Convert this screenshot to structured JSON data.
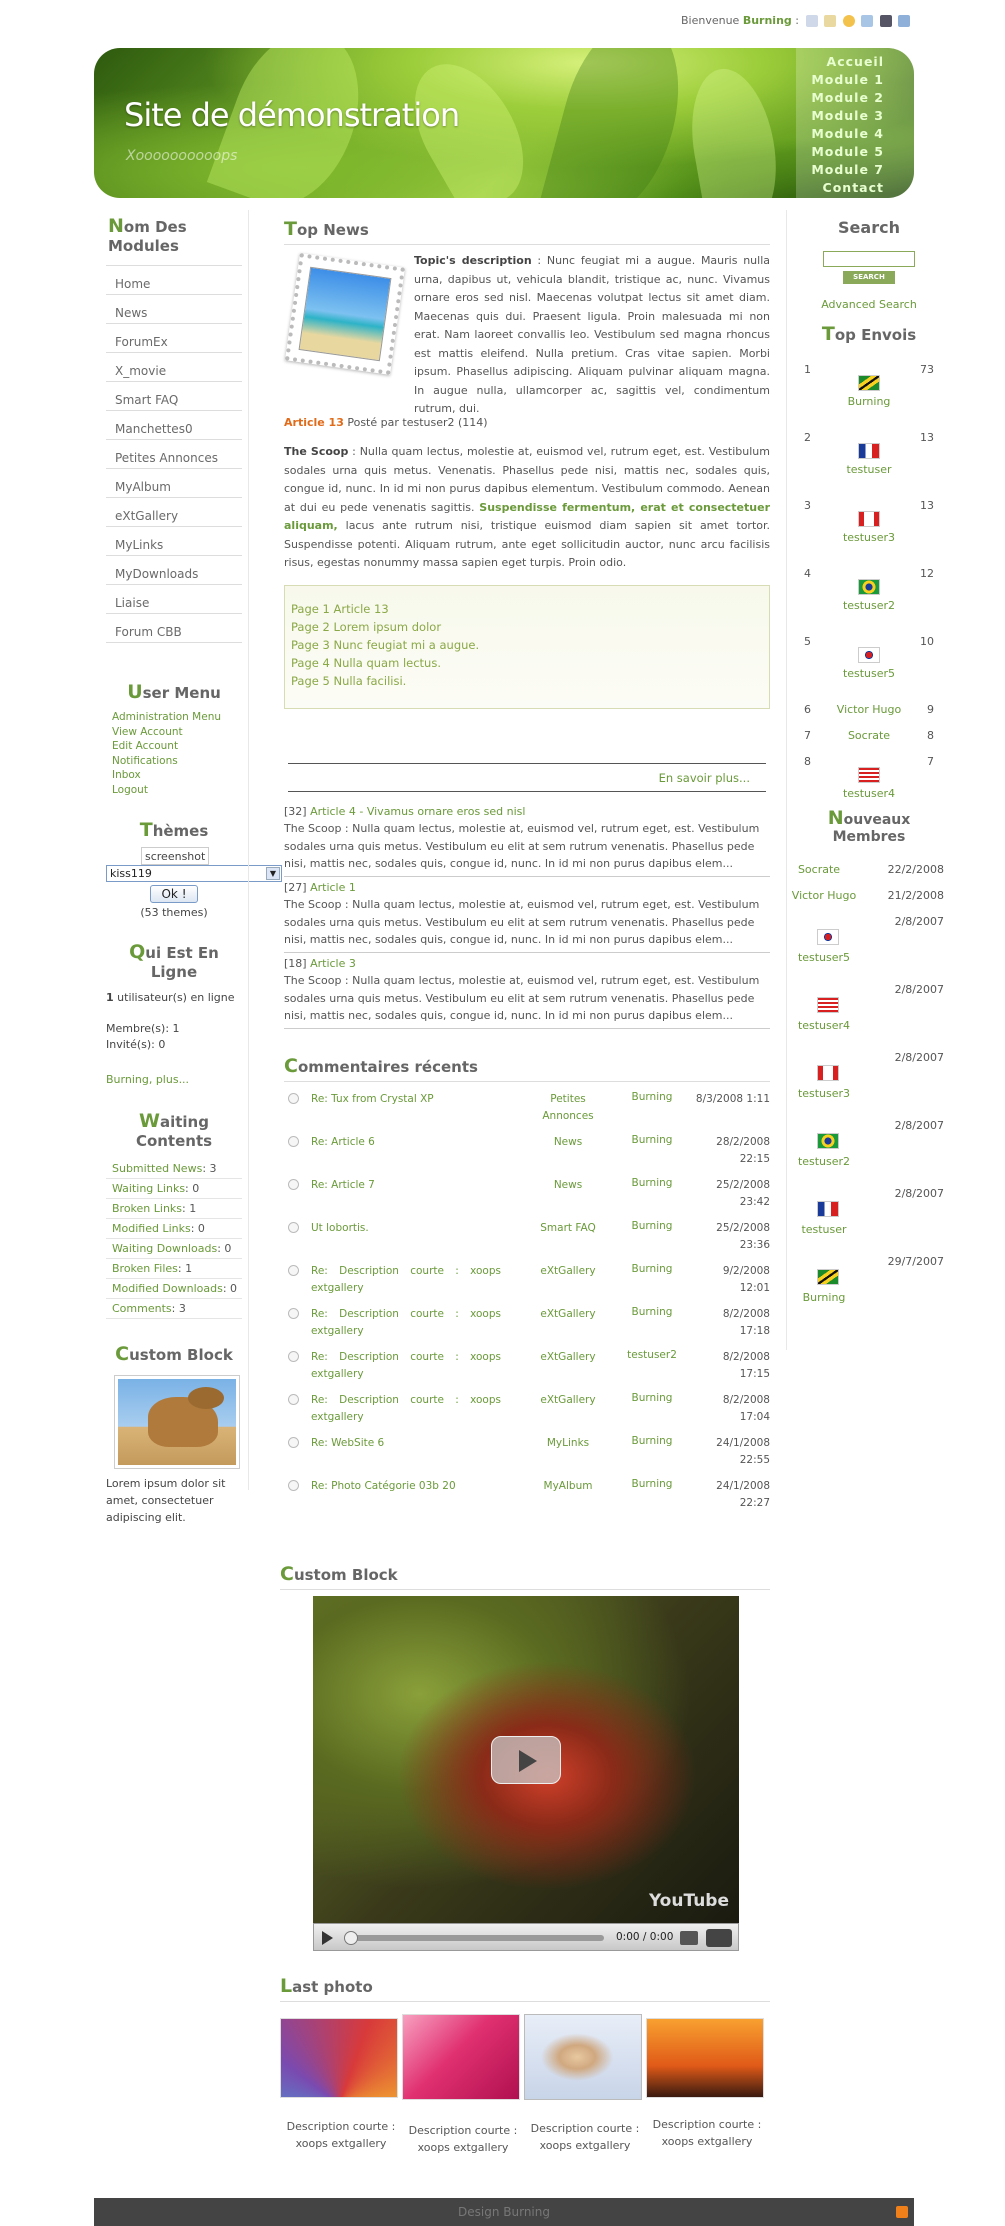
{
  "topbar": {
    "welcome": "Bienvenue",
    "username": "Burning",
    "sep": ":"
  },
  "header": {
    "title": "Site de démonstration",
    "slogan": "Xoooooooooops",
    "menu": [
      "Accueil",
      "Module 1",
      "Module 2",
      "Module 3",
      "Module 4",
      "Module 5",
      "Module 7",
      "Contact"
    ]
  },
  "modules": {
    "title_first": "N",
    "title_rest": "om Des Modules",
    "items": [
      "Home",
      "News",
      "ForumEx",
      "X_movie",
      "Smart FAQ",
      "Manchettes0",
      "Petites Annonces",
      "MyAlbum",
      "eXtGallery",
      "MyLinks",
      "MyDownloads",
      "Liaise",
      "Forum CBB"
    ]
  },
  "usermenu": {
    "title_first": "U",
    "title_rest": "ser Menu",
    "items": [
      "Administration Menu",
      "View Account",
      "Edit Account",
      "Notifications",
      "Inbox",
      "Logout"
    ]
  },
  "themes": {
    "title_first": "T",
    "title_rest": "hèmes",
    "preview": "screenshot",
    "selected": "kiss119",
    "ok": "Ok !",
    "count": "(53 themes)"
  },
  "online": {
    "title_first": "Q",
    "title_rest": "ui Est En Ligne",
    "count_num": "1",
    "count_text": " utilisateur(s) en ligne",
    "members": "Membre(s): 1",
    "guests": "Invité(s): 0",
    "more": "Burning, plus..."
  },
  "waiting": {
    "title_first": "W",
    "title_rest": "aiting Contents",
    "items": [
      {
        "k": "Submitted News",
        "v": ": 3"
      },
      {
        "k": "Waiting Links",
        "v": ": 0"
      },
      {
        "k": "Broken Links",
        "v": ": 1"
      },
      {
        "k": "Modified Links",
        "v": ": 0"
      },
      {
        "k": "Waiting Downloads",
        "v": ": 0"
      },
      {
        "k": "Broken Files",
        "v": ": 1"
      },
      {
        "k": "Modified Downloads",
        "v": ": 0"
      },
      {
        "k": "Comments",
        "v": ": 3"
      }
    ]
  },
  "customleft": {
    "title_first": "C",
    "title_rest": "ustom Block",
    "text": "Lorem ipsum dolor sit amet, consectetuer adipiscing elit."
  },
  "topnews": {
    "title_first": "T",
    "title_rest": "op News",
    "desc_label": "Topic's description",
    "desc_text": " : Nunc feugiat mi a augue. Mauris nulla urna, dapibus ut, vehicula blandit, tristique ac, nunc. Vivamus ornare eros sed nisl. Maecenas volutpat lectus sit amet diam. Maecenas quis dui. Praesent ligula. Proin malesuada mi non erat. Nam laoreet convallis leo. Vestibulum sed magna rhoncus est mattis eleifend. Nulla pretium. Cras vitae sapien. Morbi ipsum. Phasellus adipiscing. Aliquam pulvinar aliquam magna. In augue nulla, ullamcorper ac, sagittis vel, condimentum rutrum, dui.",
    "article_link": "Article 13",
    "article_meta": " Posté par testuser2 (114)",
    "scoop_label": "The Scoop",
    "scoop_a": " : Nulla quam lectus, molestie at, euismod vel, rutrum eget, est. Vestibulum sodales urna quis metus. Venenatis. Phasellus pede nisi, mattis nec, sodales quis, congue id, nunc. In id mi non purus dapibus elementum. Vestibulum commodo. Aenean at dui eu pede venenatis sagittis. ",
    "scoop_b": "Suspendisse fermentum, erat et consectetuer aliquam,",
    "scoop_c": " lacus ante rutrum nisi, tristique euismod diam sapien sit amet tortor. Suspendisse potenti. Aliquam rutrum, ante eget sollicitudin auctor, nunc arcu facilisis risus, egestas nonummy massa sapien eget turpis. Proin odio.",
    "pages": [
      "Page 1 Article 13",
      "Page 2 Lorem ipsum dolor",
      "Page 3 Nunc feugiat mi a augue.",
      "Page 4 Nulla quam lectus.",
      "Page 5 Nulla facilisi."
    ],
    "more": "En savoir plus...",
    "articles": [
      {
        "id": "[32]",
        "title": "Article 4 - Vivamus ornare eros sed nisl",
        "text": "The Scoop : Nulla quam lectus, molestie at, euismod vel, rutrum eget, est. Vestibulum sodales urna quis metus. Vestibulum eu elit at sem rutrum venenatis. Phasellus pede nisi, mattis nec, sodales quis, congue id, nunc. In id mi non purus dapibus elem..."
      },
      {
        "id": "[27]",
        "title": "Article 1",
        "text": "The Scoop : Nulla quam lectus, molestie at, euismod vel, rutrum eget, est. Vestibulum sodales urna quis metus. Vestibulum eu elit at sem rutrum venenatis. Phasellus pede nisi, mattis nec, sodales quis, congue id, nunc. In id mi non purus dapibus elem..."
      },
      {
        "id": "[18]",
        "title": "Article 3",
        "text": "The Scoop : Nulla quam lectus, molestie at, euismod vel, rutrum eget, est. Vestibulum sodales urna quis metus. Vestibulum eu elit at sem rutrum venenatis. Phasellus pede nisi, mattis nec, sodales quis, congue id, nunc. In id mi non purus dapibus elem..."
      }
    ]
  },
  "comments": {
    "title_first": "C",
    "title_rest": "ommentaires récents",
    "rows": [
      {
        "t": "Re: Tux from Crystal XP",
        "m": "Petites Annonces",
        "u": "Burning",
        "d": "8/3/2008 1:11"
      },
      {
        "t": "Re: Article 6",
        "m": "News",
        "u": "Burning",
        "d": "28/2/2008 22:15"
      },
      {
        "t": "Re: Article 7",
        "m": "News",
        "u": "Burning",
        "d": "25/2/2008 23:42"
      },
      {
        "t": "Ut lobortis.",
        "m": "Smart FAQ",
        "u": "Burning",
        "d": "25/2/2008 23:36"
      },
      {
        "t": "Re: Description courte : xoops extgallery",
        "m": "eXtGallery",
        "u": "Burning",
        "d": "9/2/2008 12:01"
      },
      {
        "t": "Re: Description courte : xoops extgallery",
        "m": "eXtGallery",
        "u": "Burning",
        "d": "8/2/2008 17:18"
      },
      {
        "t": "Re: Description courte : xoops extgallery",
        "m": "eXtGallery",
        "u": "testuser2",
        "d": "8/2/2008 17:15"
      },
      {
        "t": "Re: Description courte : xoops extgallery",
        "m": "eXtGallery",
        "u": "Burning",
        "d": "8/2/2008 17:04"
      },
      {
        "t": "Re: WebSite 6",
        "m": "MyLinks",
        "u": "Burning",
        "d": "24/1/2008 22:55"
      },
      {
        "t": "Re: Photo Catégorie 03b 20",
        "m": "MyAlbum",
        "u": "Burning",
        "d": "24/1/2008 22:27"
      }
    ]
  },
  "customvideo": {
    "title_first": "C",
    "title_rest": "ustom Block",
    "time": "0:00 / 0:00",
    "brand": "YouTube"
  },
  "lastphoto": {
    "title_first": "L",
    "title_rest": "ast photo",
    "caption": "Description courte : xoops extgallery",
    "count": 4
  },
  "search": {
    "title": "Search",
    "button": "Search",
    "advanced": "Advanced Search"
  },
  "topenvois": {
    "title_first": "T",
    "title_rest": "op Envois",
    "rows": [
      {
        "n": "1",
        "c": "73",
        "name": "Burning",
        "flag": "jm"
      },
      {
        "n": "2",
        "c": "13",
        "name": "testuser",
        "flag": "fr"
      },
      {
        "n": "3",
        "c": "13",
        "name": "testuser3",
        "flag": "ca"
      },
      {
        "n": "4",
        "c": "12",
        "name": "testuser2",
        "flag": "br"
      },
      {
        "n": "5",
        "c": "10",
        "name": "testuser5",
        "flag": "kr"
      },
      {
        "n": "6",
        "c": "9",
        "name": "Victor Hugo",
        "flag": ""
      },
      {
        "n": "7",
        "c": "8",
        "name": "Socrate",
        "flag": ""
      },
      {
        "n": "8",
        "c": "7",
        "name": "testuser4",
        "flag": "us"
      }
    ]
  },
  "newmembers": {
    "title_first": "N",
    "title_rest": "ouveaux Membres",
    "rows": [
      {
        "name": "Socrate",
        "date": "22/2/2008",
        "flag": ""
      },
      {
        "name": "Victor Hugo",
        "date": "21/2/2008",
        "flag": ""
      },
      {
        "name": "testuser5",
        "date": "2/8/2007",
        "flag": "kr"
      },
      {
        "name": "testuser4",
        "date": "2/8/2007",
        "flag": "us"
      },
      {
        "name": "testuser3",
        "date": "2/8/2007",
        "flag": "ca"
      },
      {
        "name": "testuser2",
        "date": "2/8/2007",
        "flag": "br"
      },
      {
        "name": "testuser",
        "date": "2/8/2007",
        "flag": "fr"
      },
      {
        "name": "Burning",
        "date": "29/7/2007",
        "flag": "jm"
      }
    ]
  },
  "footer": {
    "text": "Design Burning"
  },
  "colors": {
    "accent": "#6a9a3a",
    "orange": "#e06b1a"
  }
}
